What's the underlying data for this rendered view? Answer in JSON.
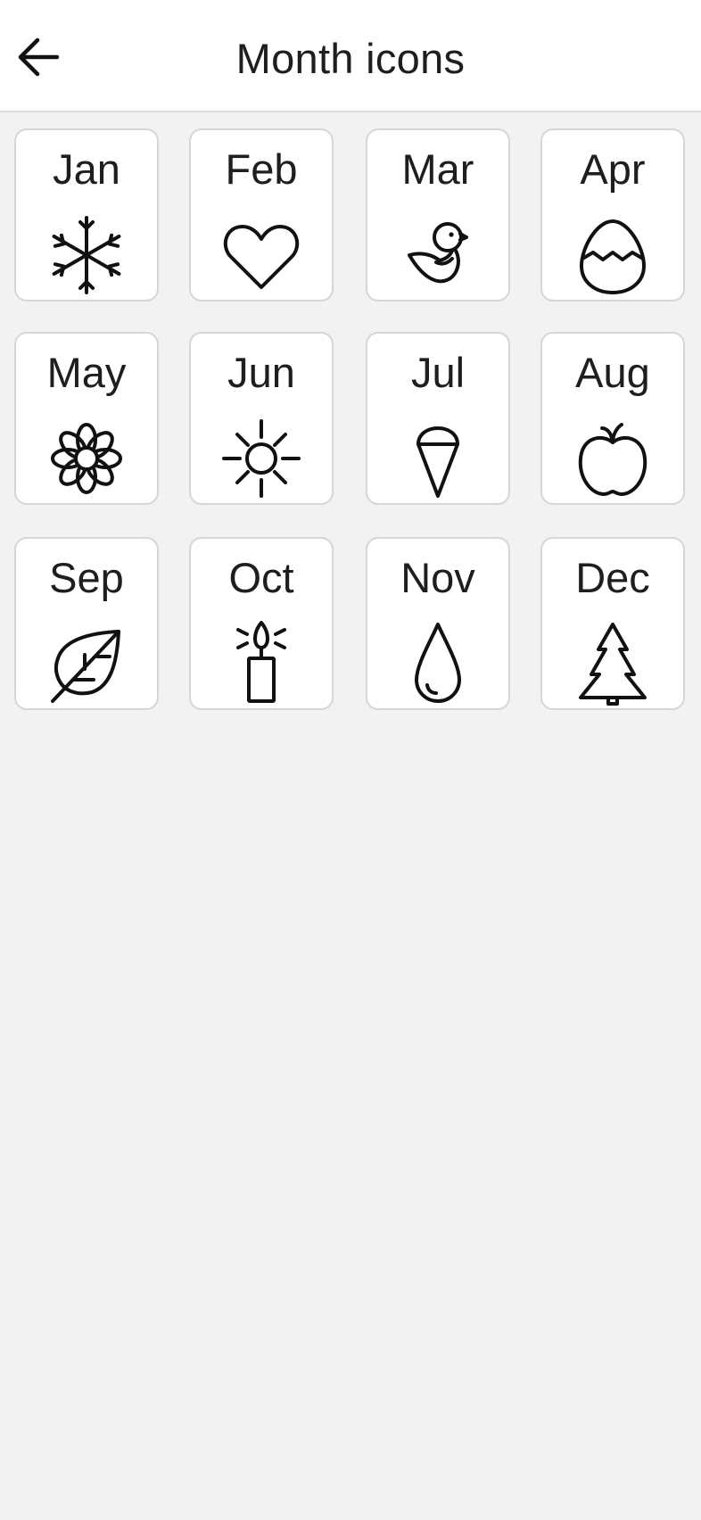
{
  "header": {
    "title": "Month icons",
    "back_icon": "arrow-left-icon"
  },
  "months": [
    {
      "label": "Jan",
      "icon": "snowflake-icon"
    },
    {
      "label": "Feb",
      "icon": "heart-icon"
    },
    {
      "label": "Mar",
      "icon": "bird-icon"
    },
    {
      "label": "Apr",
      "icon": "easter-egg-icon"
    },
    {
      "label": "May",
      "icon": "flower-icon"
    },
    {
      "label": "Jun",
      "icon": "sun-icon"
    },
    {
      "label": "Jul",
      "icon": "ice-cream-cone-icon"
    },
    {
      "label": "Aug",
      "icon": "apple-icon"
    },
    {
      "label": "Sep",
      "icon": "leaf-icon"
    },
    {
      "label": "Oct",
      "icon": "candle-icon"
    },
    {
      "label": "Nov",
      "icon": "raindrop-icon"
    },
    {
      "label": "Dec",
      "icon": "christmas-tree-icon"
    }
  ]
}
